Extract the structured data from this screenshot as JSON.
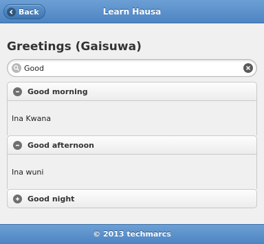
{
  "header": {
    "back_label": "Back",
    "title": "Learn Hausa"
  },
  "page": {
    "title": "Greetings (Gaisuwa)"
  },
  "search": {
    "value": "Good"
  },
  "items": [
    {
      "label": "Good morning",
      "translation": "Ina Kwana",
      "expanded": true,
      "icon": "minus-icon"
    },
    {
      "label": "Good afternoon",
      "translation": "Ina wuni",
      "expanded": true,
      "icon": "minus-icon"
    },
    {
      "label": "Good night",
      "translation": "",
      "expanded": false,
      "icon": "plus-icon"
    }
  ],
  "footer": {
    "text": "© 2013 techmarcs"
  },
  "colors": {
    "bar": "#5a8fcc",
    "background": "#f0f0f0"
  }
}
